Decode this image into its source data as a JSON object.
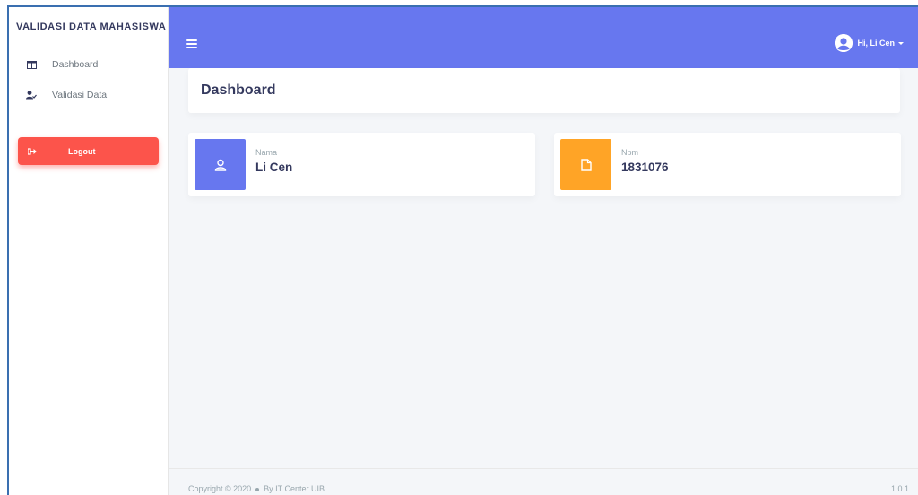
{
  "sidebar": {
    "brand": "VALIDASI DATA MAHASISWA",
    "items": [
      {
        "label": "Dashboard",
        "icon": "columns-icon"
      },
      {
        "label": "Validasi Data",
        "icon": "user-check-icon"
      }
    ],
    "logout": {
      "label": "Logout",
      "icon": "sign-out-icon"
    }
  },
  "navbar": {
    "menu_icon": "hamburger-icon",
    "user_label": "Hi, Li Cen",
    "accent": "#6777ef"
  },
  "main": {
    "title": "Dashboard",
    "cards": [
      {
        "label": "Nama",
        "value": "Li Cen",
        "icon": "user-icon",
        "color": "#6777ef"
      },
      {
        "label": "Npm",
        "value": "1831076",
        "icon": "file-icon",
        "color": "#ffa426"
      }
    ]
  },
  "footer": {
    "copyright": "Copyright © 2020",
    "by": "By IT Center UIB",
    "version": "1.0.1"
  },
  "colors": {
    "logout": "#fc544b",
    "background": "#f4f6f9"
  }
}
